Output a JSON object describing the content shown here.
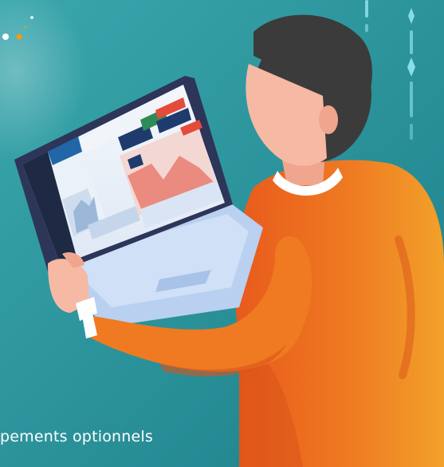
{
  "caption": "pements optionnels",
  "colors": {
    "background": "#2f9aa3",
    "background_dark": "#1f7f8a",
    "shirt": "#ef7a22",
    "shirt_shadow": "#d9601a",
    "skin": "#f6b9a4",
    "hair": "#3b3b3b",
    "laptop_frame": "#2d3558",
    "laptop_body": "#bcd4f4",
    "accent_red": "#e44b3a",
    "accent_orange": "#f39c12"
  },
  "icons": [
    "laptop-icon",
    "person-illustration"
  ]
}
